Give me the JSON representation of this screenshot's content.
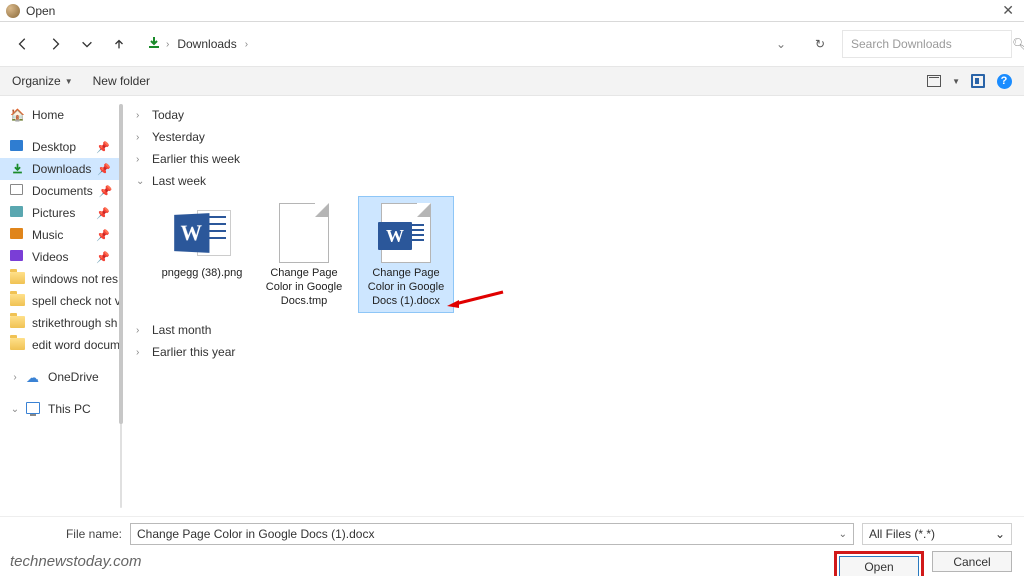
{
  "titlebar": {
    "title": "Open"
  },
  "nav": {
    "path": "Downloads",
    "search_placeholder": "Search Downloads"
  },
  "toolbar": {
    "organize": "Organize",
    "new_folder": "New folder"
  },
  "sidebar": {
    "home": "Home",
    "items": [
      {
        "label": "Desktop"
      },
      {
        "label": "Downloads"
      },
      {
        "label": "Documents"
      },
      {
        "label": "Pictures"
      },
      {
        "label": "Music"
      },
      {
        "label": "Videos"
      },
      {
        "label": "windows not res"
      },
      {
        "label": "spell check not v"
      },
      {
        "label": "strikethrough sh"
      },
      {
        "label": "edit word docum"
      }
    ],
    "onedrive": "OneDrive",
    "this_pc": "This PC"
  },
  "groups": {
    "today": "Today",
    "yesterday": "Yesterday",
    "earlier_week": "Earlier this week",
    "last_week": "Last week",
    "last_month": "Last month",
    "earlier_year": "Earlier this year"
  },
  "files": [
    {
      "name": "pngegg (38).png"
    },
    {
      "name": "Change Page Color in Google Docs.tmp"
    },
    {
      "name": "Change Page Color in Google Docs (1).docx"
    }
  ],
  "footer": {
    "file_name_label": "File name:",
    "file_name_value": "Change Page Color in Google Docs (1).docx",
    "filter": "All Files (*.*)",
    "open": "Open",
    "cancel": "Cancel"
  },
  "watermark": "technewstoday.com"
}
